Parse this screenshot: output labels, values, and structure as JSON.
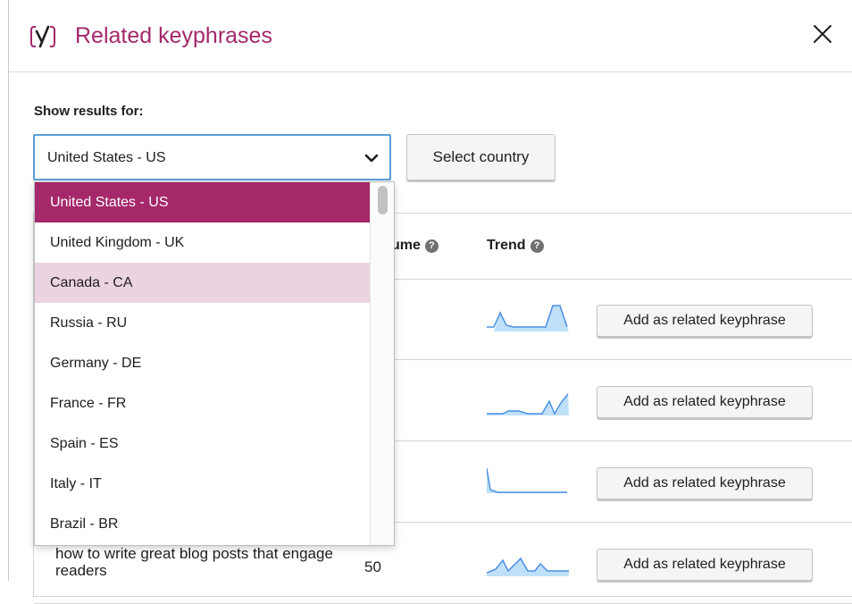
{
  "header": {
    "title": "Related keyphrases",
    "logo_icon": "yoast-logo-icon",
    "close_icon": "close-icon"
  },
  "colors": {
    "brand": "#a4286a",
    "focus": "#5b9dd9",
    "hover_option": "#ecd3e2",
    "trend_line": "#4a90e2",
    "trend_fill": "#bfe0f8"
  },
  "filter": {
    "label": "Show results for:",
    "selected_value": "United States - US",
    "select_country_button": "Select country",
    "options": [
      "United States - US",
      "United Kingdom - UK",
      "Canada - CA",
      "Russia - RU",
      "Germany - DE",
      "France - FR",
      "Spain - ES",
      "Italy - IT",
      "Brazil - BR"
    ],
    "highlighted_option": "Canada - CA"
  },
  "table": {
    "columns": {
      "volume_partial": "ume",
      "trend": "Trend"
    },
    "add_button_label": "Add as related keyphrase",
    "rows": [
      {
        "keyphrase": "",
        "volume": ""
      },
      {
        "keyphrase": "",
        "volume": ""
      },
      {
        "keyphrase": "",
        "volume": ""
      },
      {
        "keyphrase": "how to write great blog posts that engage readers",
        "volume": "50"
      }
    ]
  }
}
